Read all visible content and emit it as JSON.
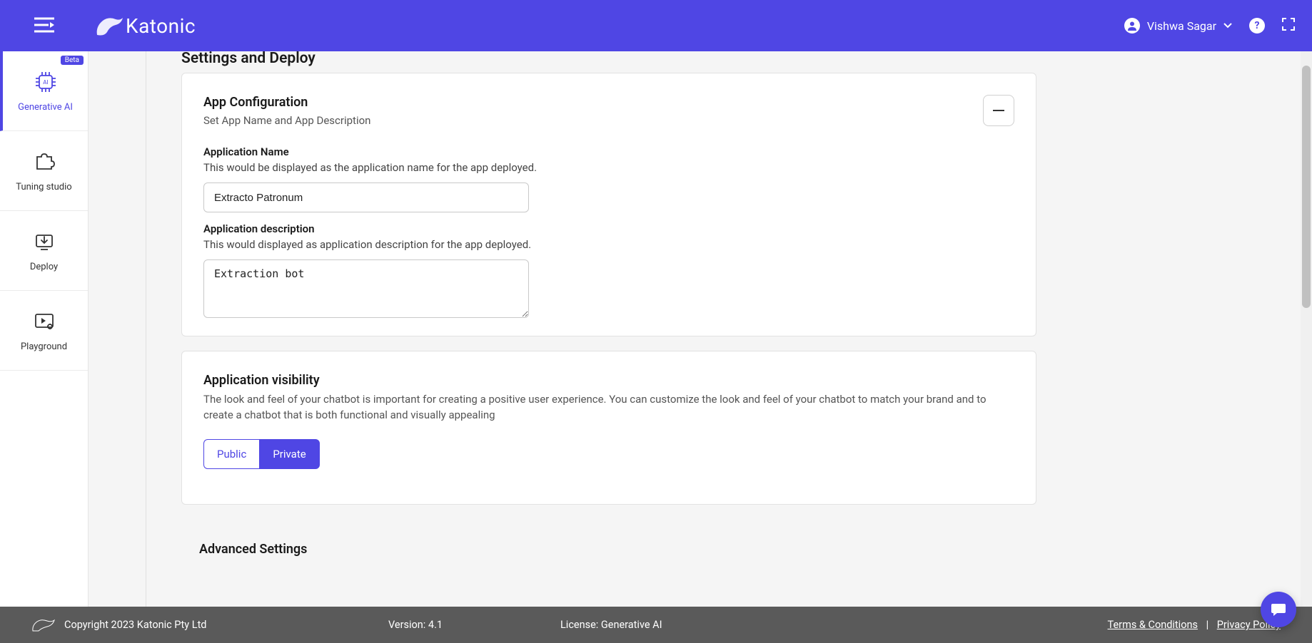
{
  "header": {
    "brand": "Katonic",
    "user_name": "Vishwa Sagar"
  },
  "sidebar": {
    "items": [
      {
        "label": "Generative AI",
        "badge": "Beta"
      },
      {
        "label": "Tuning studio"
      },
      {
        "label": "Deploy"
      },
      {
        "label": "Playground"
      }
    ]
  },
  "page": {
    "title": "Settings and Deploy",
    "app_config": {
      "heading": "App Configuration",
      "sub": "Set App Name and App Description",
      "name_label": "Application Name",
      "name_help": "This would be displayed as the application name for the app deployed.",
      "name_value": "Extracto Patronum",
      "desc_label": "Application description",
      "desc_help": "This would displayed as application description for the app deployed.",
      "desc_value": "Extraction bot"
    },
    "visibility": {
      "heading": "Application visibility",
      "sub": "The look and feel of your chatbot is important for creating a positive user experience. You can customize the look and feel of your chatbot to match your brand and to create a chatbot that is both functional and visually appealing",
      "public_label": "Public",
      "private_label": "Private"
    },
    "advanced_heading": "Advanced Settings"
  },
  "footer": {
    "copyright": "Copyright 2023 Katonic Pty Ltd",
    "version": "Version: 4.1",
    "license": "License: Generative AI",
    "terms": "Terms & Conditions",
    "privacy": "Privacy Policy"
  }
}
